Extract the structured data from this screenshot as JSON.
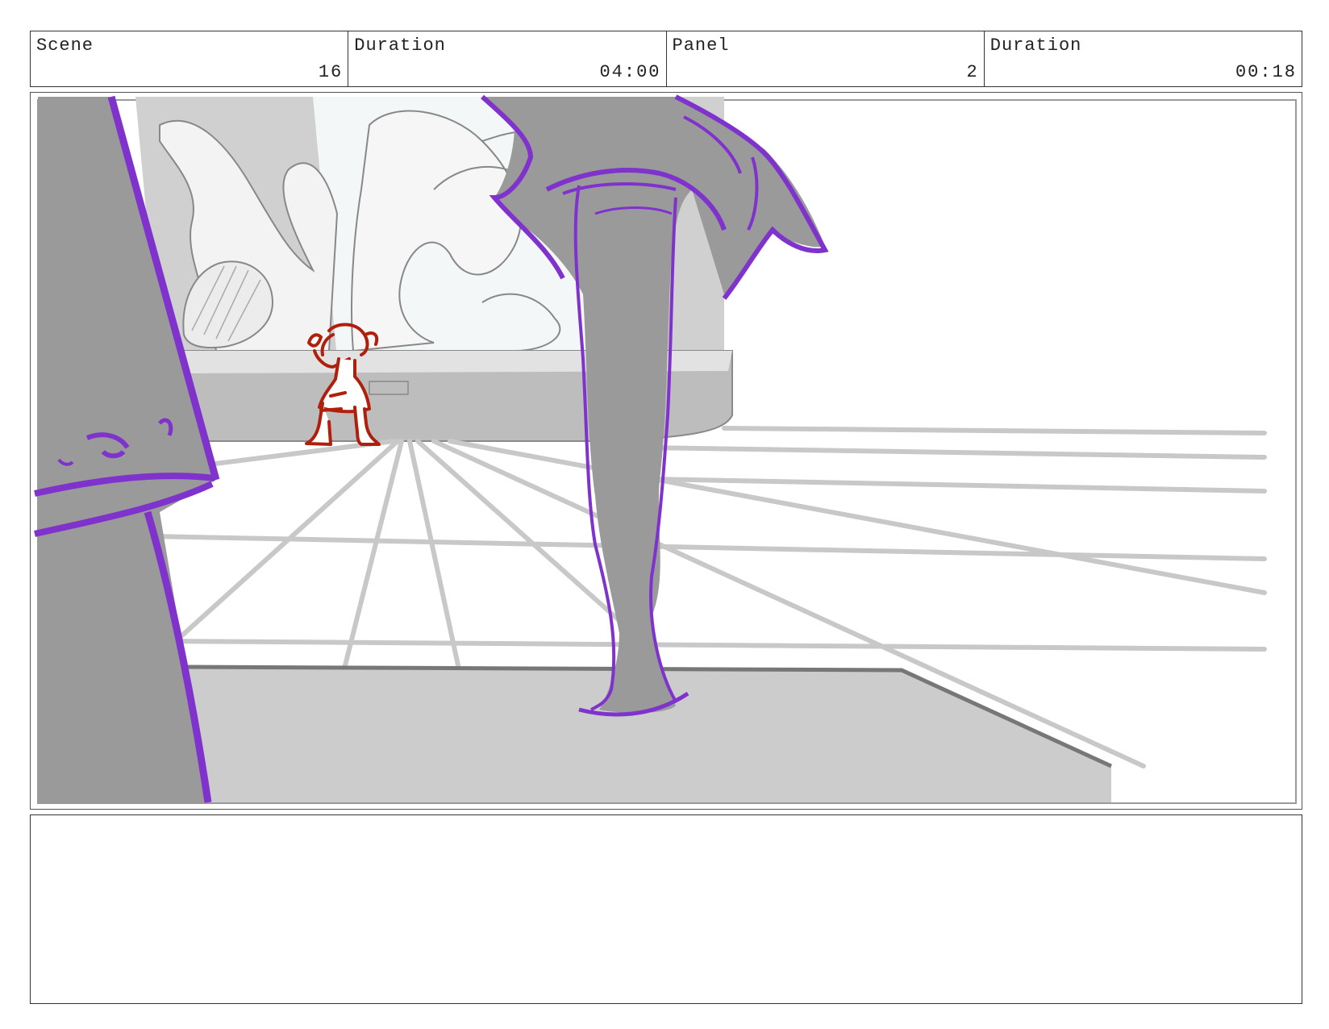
{
  "header": {
    "scene_label": "Scene",
    "scene_value": "16",
    "scene_duration_label": "Duration",
    "scene_duration_value": "04:00",
    "panel_label": "Panel",
    "panel_value": "2",
    "panel_duration_label": "Duration",
    "panel_duration_value": "00:18"
  },
  "drawing": {
    "line_color": "#8033cc",
    "small_figure_color": "#b01e0c",
    "shade_dark": "#9a9a9a",
    "shade_light": "#cccccc"
  },
  "notes": {
    "text": ""
  }
}
